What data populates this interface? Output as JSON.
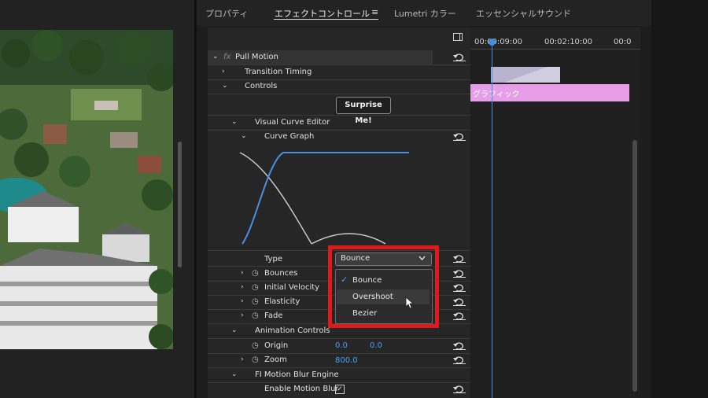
{
  "tabs": [
    {
      "label": "プロパティ"
    },
    {
      "label": "エフェクトコントロール"
    },
    {
      "label": "Lumetri カラー"
    },
    {
      "label": "エッセンシャルサウンド"
    }
  ],
  "effect": {
    "fx": "fx",
    "name": "Pull Motion",
    "transition_timing": "Transition Timing",
    "controls": "Controls",
    "surprise_button": "Surprise Me!",
    "visual_curve_editor": "Visual Curve Editor",
    "curve_graph": "Curve Graph",
    "type_label": "Type",
    "type_value": "Bounce",
    "type_options": [
      "Bounce",
      "Overshoot",
      "Bezier"
    ],
    "bounces": "Bounces",
    "initial_velocity": "Initial Velocity",
    "elasticity": "Elasticity",
    "fade": "Fade",
    "animation_controls": "Animation Controls",
    "origin": "Origin",
    "origin_x": "0.0",
    "origin_y": "0.0",
    "zoom": "Zoom",
    "zoom_value": "800.0",
    "fi_motion_blur": "FI Motion Blur Engine",
    "enable_motion_blur": "Enable Motion Blur"
  },
  "timeline": {
    "ticks": [
      "00:00:09:00",
      "00:02:10:00",
      "00:0"
    ],
    "clip_label": "グラフィック"
  },
  "colors": {
    "accent": "#3f8fe3",
    "graphic_clip": "#e69ee8",
    "highlight_box": "#e01919",
    "curve_blue": "#4a90e2",
    "curve_gray": "#c9c9c9"
  },
  "icons": [
    "panel-menu-icon",
    "panel-toggle-icon",
    "reset-icon",
    "stopwatch-icon",
    "checkmark-icon",
    "chevron-down-icon",
    "mouse-cursor-icon"
  ]
}
